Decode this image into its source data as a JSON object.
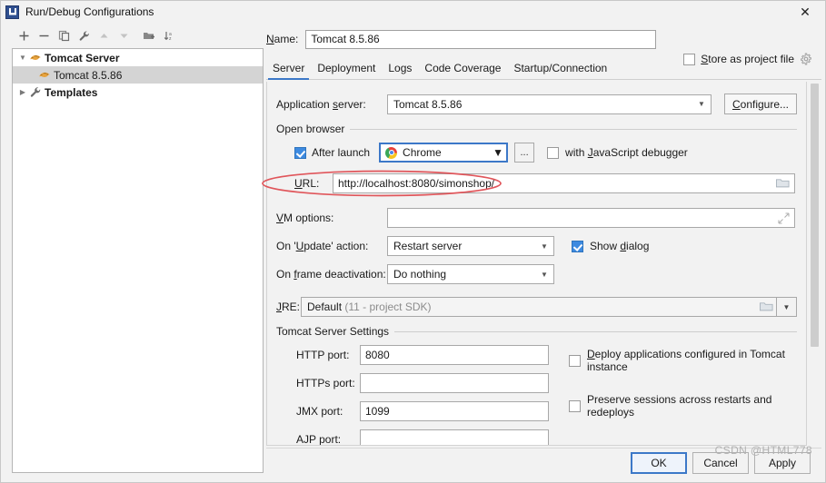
{
  "window": {
    "title": "Run/Debug Configurations",
    "icon": "intellij-idea-icon",
    "close_label": "✕"
  },
  "sidebar": {
    "toolbar": [
      {
        "name": "add-button",
        "glyph": "+"
      },
      {
        "name": "remove-button",
        "glyph": "−"
      },
      {
        "name": "copy-button",
        "glyph": "copy-icon"
      },
      {
        "name": "edit-templates-button",
        "glyph": "wrench-icon"
      },
      {
        "name": "move-up-button",
        "glyph": "triangle-up-icon"
      },
      {
        "name": "move-down-button",
        "glyph": "triangle-down-icon"
      },
      {
        "name": "move-into-folder-button",
        "glyph": "folder-add-icon"
      },
      {
        "name": "sort-configurations-button",
        "glyph": "sort-az-icon"
      }
    ],
    "tree": [
      {
        "label": "Tomcat Server",
        "bold": true,
        "expanded": true,
        "level": 0,
        "icon": "tomcat-icon",
        "selected": false
      },
      {
        "label": "Tomcat 8.5.86",
        "bold": false,
        "expanded": null,
        "level": 1,
        "icon": "tomcat-icon",
        "selected": true
      },
      {
        "label": "Templates",
        "bold": true,
        "expanded": false,
        "level": 0,
        "icon": "wrench-icon",
        "selected": false
      }
    ]
  },
  "header": {
    "name_label": "Name:",
    "name_value": "Tomcat 8.5.86",
    "store_as_project_file_label": "Store as project file",
    "store_as_project_file_checked": false,
    "gear_icon": "gear-icon"
  },
  "tabs": [
    {
      "label": "Server",
      "active": true
    },
    {
      "label": "Deployment",
      "active": false
    },
    {
      "label": "Logs",
      "active": false
    },
    {
      "label": "Code Coverage",
      "active": false
    },
    {
      "label": "Startup/Connection",
      "active": false
    }
  ],
  "server_tab": {
    "application_server_label": "Application server:",
    "application_server_value": "Tomcat 8.5.86",
    "configure_button": "Configure...",
    "open_browser_group": "Open browser",
    "after_launch_label": "After launch",
    "after_launch_checked": true,
    "browser_value": "Chrome",
    "browser_icon": "chrome-icon",
    "browse_button": "...",
    "js_debugger_label": "with JavaScript debugger",
    "js_debugger_checked": false,
    "url_label": "URL:",
    "url_value": "http://localhost:8080/simonshop/",
    "url_folder_icon": "folder-icon",
    "vm_options_label": "VM options:",
    "vm_options_value": "",
    "vm_options_expand_icon": "expand-icon",
    "on_update_label": "On 'Update' action:",
    "on_update_value": "Restart server",
    "show_dialog_label": "Show dialog",
    "show_dialog_checked": true,
    "on_frame_deactivation_label": "On frame deactivation:",
    "on_frame_deactivation_value": "Do nothing",
    "jre_label": "JRE:",
    "jre_value": "Default",
    "jre_value_hint": "(11 - project SDK)",
    "jre_folder_icon": "folder-icon",
    "jre_dropdown_icon": "chevron-down-icon",
    "tomcat_settings_group": "Tomcat Server Settings",
    "ports": [
      {
        "label": "HTTP port:",
        "value": "8080",
        "name": "http-port"
      },
      {
        "label": "HTTPs port:",
        "value": "",
        "name": "https-port"
      },
      {
        "label": "JMX port:",
        "value": "1099",
        "name": "jmx-port"
      },
      {
        "label": "AJP port:",
        "value": "",
        "name": "ajp-port"
      }
    ],
    "options": [
      {
        "label": "Deploy applications configured in Tomcat instance",
        "checked": false,
        "name": "deploy-applications-checkbox"
      },
      {
        "label": "Preserve sessions across restarts and redeploys",
        "checked": false,
        "name": "preserve-sessions-checkbox"
      }
    ]
  },
  "footer": {
    "ok_label": "OK",
    "cancel_label": "Cancel",
    "apply_label": "Apply"
  },
  "watermark": "CSDN @HTML778",
  "annotation": {
    "shape": "ellipse",
    "color": "#e0565b",
    "target": "url-field-row"
  },
  "colors": {
    "accent": "#3c78c8",
    "panel_bg": "#f2f2f2",
    "field_bg": "#ffffff",
    "selection": "#d4d4d4",
    "annotation_red": "#e0565b"
  }
}
